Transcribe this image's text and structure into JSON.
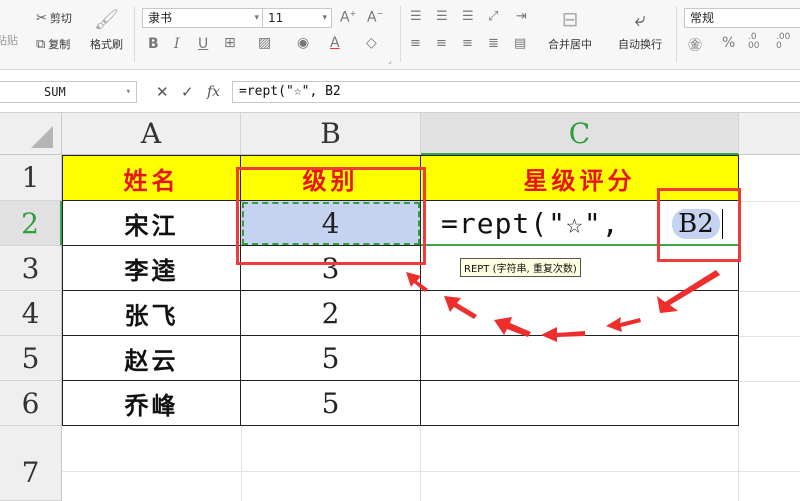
{
  "ribbon": {
    "clipboard": {
      "cut": "剪切",
      "copy": "复制",
      "paste_partial": "粘贴",
      "format_painter": "格式刷"
    },
    "font": {
      "name": "隶书",
      "size": "11"
    },
    "align": {
      "merge_center": "合并居中",
      "wrap_text": "自动换行"
    },
    "number": {
      "format": "常规"
    }
  },
  "formula_bar": {
    "name_box": "SUM",
    "fx_label": "fx",
    "formula": "=rept(\"☆\", B2"
  },
  "sheet": {
    "columns": [
      "A",
      "B",
      "C"
    ],
    "rows": [
      "1",
      "2",
      "3",
      "4",
      "5",
      "6",
      "7"
    ],
    "header_row": {
      "name": "姓名",
      "level": "级别",
      "rating": "星级评分"
    },
    "data": [
      {
        "name": "宋江",
        "level": "4"
      },
      {
        "name": "李逵",
        "level": "3"
      },
      {
        "name": "张飞",
        "level": "2"
      },
      {
        "name": "赵云",
        "level": "5"
      },
      {
        "name": "乔峰",
        "level": "5"
      }
    ],
    "editing_formula": "=rept(\"☆\",",
    "ref_chip": "B2",
    "tooltip": "REPT (字符串, 重复次数)"
  },
  "colors": {
    "header_fill": "#ffff00",
    "header_text": "#e8141a",
    "selection_fill": "#c5d3f0",
    "annotation_red": "#ee3b3b",
    "active_green": "#2e9d3d"
  }
}
